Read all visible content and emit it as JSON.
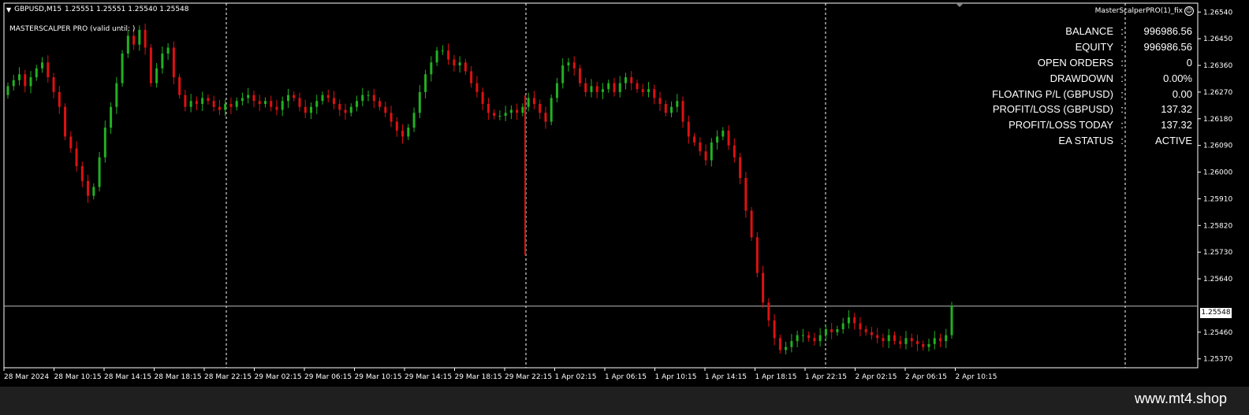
{
  "header": {
    "symbol": "GBPUSD,M15",
    "ohlc": "1.25551 1.25551 1.25540 1.25548"
  },
  "ea_label": "MASTERSCALPER PRO (valid until: )",
  "ea_name": "MasterScalperPRO(1)_fix",
  "info_panel": [
    {
      "label": "BALANCE",
      "sep": ":",
      "value": "996986.56"
    },
    {
      "label": "EQUITY",
      "sep": ":",
      "value": "996986.56"
    },
    {
      "label": "OPEN ORDERS",
      "sep": ":",
      "value": "0"
    },
    {
      "label": "DRAWDOWN",
      "sep": ":",
      "value": "0.00%"
    },
    {
      "label": "FLOATING P/L (GBPUSD)",
      "sep": ":",
      "value": "0.00"
    },
    {
      "label": "PROFIT/LOSS (GBPUSD)",
      "sep": ":",
      "value": "137.32"
    },
    {
      "label": "PROFIT/LOSS TODAY",
      "sep": ":",
      "value": "137.32"
    },
    {
      "label": "EA STATUS",
      "sep": ":",
      "value": "ACTIVE"
    }
  ],
  "current_price": "1.25548",
  "footer_text": "www.mt4.shop",
  "colors": {
    "bull": "#22b022",
    "bear": "#dd1111",
    "grid": "#ffffff",
    "background": "#000000"
  },
  "chart_data": {
    "type": "candlestick",
    "y_ticks": [
      "1.26540",
      "1.26450",
      "1.26360",
      "1.26270",
      "1.26180",
      "1.26090",
      "1.26000",
      "1.25910",
      "1.25820",
      "1.25730",
      "1.25640",
      "1.25460",
      "1.25370"
    ],
    "ylim": [
      1.2534,
      1.2657
    ],
    "x_ticks": [
      "28 Mar 2024",
      "28 Mar 10:15",
      "28 Mar 14:15",
      "28 Mar 18:15",
      "28 Mar 22:15",
      "29 Mar 02:15",
      "29 Mar 06:15",
      "29 Mar 10:15",
      "29 Mar 14:15",
      "29 Mar 18:15",
      "29 Mar 22:15",
      "1 Apr 02:15",
      "1 Apr 06:15",
      "1 Apr 10:15",
      "1 Apr 14:15",
      "1 Apr 18:15",
      "1 Apr 22:15",
      "2 Apr 02:15",
      "2 Apr 06:15",
      "2 Apr 10:15"
    ],
    "current_price": 1.25548,
    "closes": [
      1.2629,
      1.2631,
      1.2633,
      1.2629,
      1.2632,
      1.2635,
      1.2637,
      1.2632,
      1.2627,
      1.2622,
      1.2612,
      1.2608,
      1.2602,
      1.2597,
      1.2592,
      1.2595,
      1.2605,
      1.2615,
      1.2622,
      1.263,
      1.264,
      1.2646,
      1.2643,
      1.2648,
      1.2642,
      1.263,
      1.2635,
      1.264,
      1.2642,
      1.2632,
      1.2626,
      1.2622,
      1.2624,
      1.2623,
      1.2625,
      1.2624,
      1.2622,
      1.2621,
      1.2623,
      1.2622,
      1.2624,
      1.2625,
      1.2626,
      1.2624,
      1.2623,
      1.2624,
      1.2622,
      1.2621,
      1.2624,
      1.2626,
      1.2625,
      1.2622,
      1.262,
      1.2622,
      1.2624,
      1.2626,
      1.2625,
      1.2623,
      1.2621,
      1.262,
      1.2622,
      1.2624,
      1.2626,
      1.2626,
      1.2624,
      1.2622,
      1.262,
      1.2617,
      1.2614,
      1.2612,
      1.2615,
      1.262,
      1.2627,
      1.2633,
      1.2637,
      1.2641,
      1.2641,
      1.2638,
      1.2636,
      1.2637,
      1.2634,
      1.263,
      1.2627,
      1.2623,
      1.262,
      1.2619,
      1.2619,
      1.262,
      1.2621,
      1.262,
      1.2622,
      1.2625,
      1.2623,
      1.262,
      1.2617,
      1.2625,
      1.263,
      1.2636,
      1.2637,
      1.2635,
      1.263,
      1.2627,
      1.2629,
      1.2627,
      1.2628,
      1.263,
      1.2627,
      1.263,
      1.2632,
      1.263,
      1.2628,
      1.2627,
      1.2628,
      1.2625,
      1.2623,
      1.262,
      1.2622,
      1.2624,
      1.2617,
      1.2612,
      1.261,
      1.2607,
      1.2604,
      1.261,
      1.2612,
      1.2614,
      1.2609,
      1.2605,
      1.2598,
      1.2587,
      1.2578,
      1.2566,
      1.2556,
      1.255,
      1.2544,
      1.254,
      1.2541,
      1.2543,
      1.2545,
      1.2545,
      1.2544,
      1.2543,
      1.2545,
      1.2547,
      1.2546,
      1.2547,
      1.2549,
      1.2551,
      1.2549,
      1.2547,
      1.2546,
      1.2545,
      1.2544,
      1.2543,
      1.2545,
      1.2543,
      1.2542,
      1.2544,
      1.2543,
      1.2542,
      1.2541,
      1.2542,
      1.2544,
      1.2543,
      1.2545,
      1.2555
    ]
  }
}
